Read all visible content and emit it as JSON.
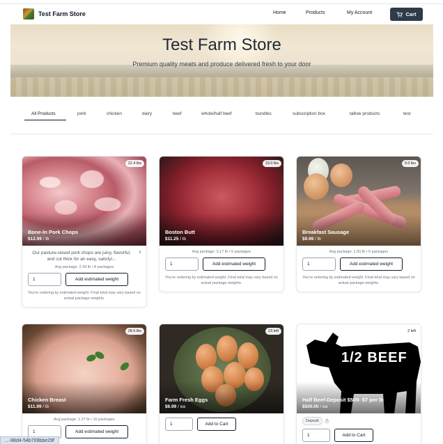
{
  "nav": {
    "brand": "Test Farm Store",
    "links": [
      "Home",
      "Products",
      "My Account"
    ],
    "cart_label": "Cart"
  },
  "hero": {
    "title": "Test Farm Store",
    "subtitle": "Premium quality meats and produce delivered fresh to your door"
  },
  "tabs": [
    "All Products",
    "pork",
    "chicken",
    "dairy",
    "beef",
    "whole/half beef",
    "bundles",
    "subscription box",
    "tallow products",
    "test"
  ],
  "products": [
    {
      "name": "Bone-In Pork Chops",
      "price": "$12.99",
      "unit": "/ lb",
      "badge": "22.4 lbs",
      "description": "Our pasture-raised pork chops are juicy, flavorful, and cut thick for an easy, satisfyi...",
      "avg": "Avg package: 2.43 lb • 8 packages",
      "qty": "1",
      "button": "Add estimated weight",
      "note": "You're ordering by estimated weight. Final total may vary based on actual package weights."
    },
    {
      "name": "Boston Butt",
      "price": "$11.25",
      "unit": "/ lb",
      "badge": "19.0 lbs",
      "avg": "Avg package: 3.17 lb • 5 packages",
      "qty": "1",
      "button": "Add estimated weight",
      "note": "You're ordering by estimated weight. Final total may vary based on actual package weights."
    },
    {
      "name": "Breakfast Sausage",
      "price": "$9.99",
      "unit": "/ lb",
      "badge": "9.0 lbs",
      "avg": "Avg package: 1.00 lb • 6 packages",
      "qty": "1",
      "button": "Add estimated weight",
      "note": "You're ordering by estimated weight. Final total may vary based on actual package weights."
    },
    {
      "name": "Chicken Breast",
      "price": "$11.99",
      "unit": "/ lb",
      "badge": "28.6 lbs",
      "avg": "Avg package: 1.27 lb • 16 packages",
      "qty": "1",
      "button": "Add estimated weight"
    },
    {
      "name": "Farm Fresh Eggs",
      "price": "$6.99",
      "unit": "/ ea",
      "badge": "23 left",
      "qty": "1",
      "button": "Add to Cart"
    },
    {
      "name": "Half Beef-Deposit $500- $7 per lb",
      "price": "$500.00",
      "unit": "/ ea",
      "badge": "2 left",
      "image_text": "1/2 BEEF",
      "deposit": "Deposit",
      "help": "?",
      "qty": "1",
      "button": "Add to Cart"
    }
  ],
  "status_url": "...-88d4-54b709bbe29f"
}
